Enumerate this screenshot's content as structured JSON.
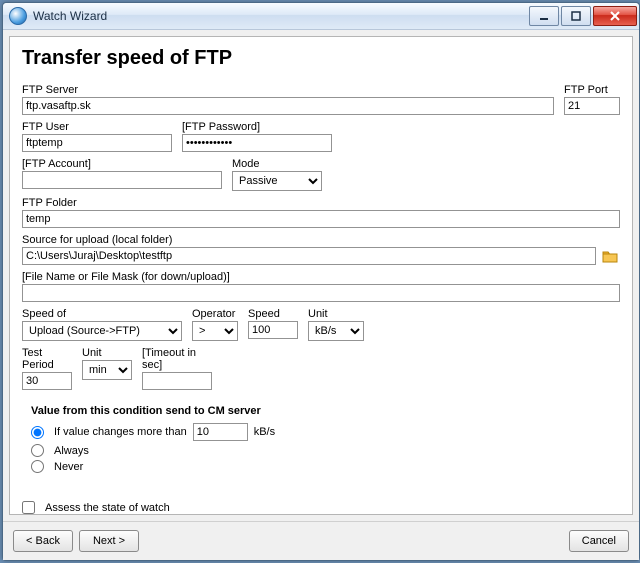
{
  "window": {
    "title": "Watch Wizard"
  },
  "heading": "Transfer speed of FTP",
  "labels": {
    "ftp_server": "FTP Server",
    "ftp_port": "FTP Port",
    "ftp_user": "FTP User",
    "ftp_password": "[FTP Password]",
    "ftp_account": "[FTP Account]",
    "mode": "Mode",
    "ftp_folder": "FTP Folder",
    "source_upload": "Source for upload (local folder)",
    "file_mask": "[File Name or File Mask (for down/upload)]",
    "speed_of": "Speed of",
    "operator": "Operator",
    "speed": "Speed",
    "unit": "Unit",
    "test_period": "Test Period",
    "tp_unit": "Unit",
    "timeout": "[Timeout in sec]"
  },
  "values": {
    "ftp_server": "ftp.vasaftp.sk",
    "ftp_port": "21",
    "ftp_user": "ftptemp",
    "ftp_password": "••••••••••••",
    "ftp_account": "",
    "mode": "Passive",
    "ftp_folder": "temp",
    "source_upload": "C:\\Users\\Juraj\\Desktop\\testftp",
    "file_mask": "",
    "speed_of": "Upload (Source->FTP)",
    "operator": ">",
    "speed": "100",
    "unit": "kB/s",
    "test_period": "30",
    "tp_unit": "min",
    "timeout": ""
  },
  "cond": {
    "title": "Value from this condition send to CM server",
    "opt_changes": "If value changes more than",
    "opt_changes_value": "10",
    "opt_changes_unit": "kB/s",
    "opt_always": "Always",
    "opt_never": "Never",
    "selected": "changes"
  },
  "assess_label": "Assess the state of watch",
  "buttons": {
    "back": "< Back",
    "next": "Next >",
    "cancel": "Cancel"
  }
}
